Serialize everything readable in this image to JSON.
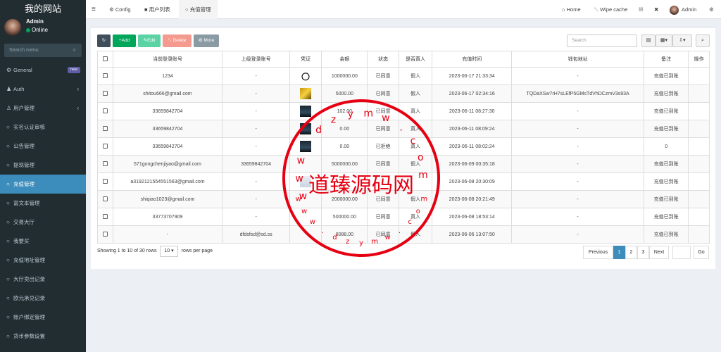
{
  "sidebar": {
    "site_name": "我的网站",
    "user_name": "Admin",
    "status": "Online",
    "search_placeholder": "Search menu",
    "items": [
      {
        "label": "General",
        "icon": "gears-icon",
        "badge": "new"
      },
      {
        "label": "Auth",
        "icon": "users-icon",
        "chevron": "‹"
      },
      {
        "label": "用户管理",
        "icon": "user-icon",
        "chevron": "‹"
      },
      {
        "label": "实名认证审核",
        "icon": "circle-icon"
      },
      {
        "label": "公告管理",
        "icon": "circle-icon"
      },
      {
        "label": "提现管理",
        "icon": "circle-icon"
      },
      {
        "label": "充值管理",
        "icon": "circle-icon",
        "active": true
      },
      {
        "label": "富文本管理",
        "icon": "circle-icon"
      },
      {
        "label": "交易大厅",
        "icon": "circle-icon"
      },
      {
        "label": "我要买",
        "icon": "circle-icon"
      },
      {
        "label": "充值地址管理",
        "icon": "circle-icon"
      },
      {
        "label": "大厅卖出记录",
        "icon": "circle-icon"
      },
      {
        "label": "欧元承兑记录",
        "icon": "circle-icon"
      },
      {
        "label": "账户绑定管理",
        "icon": "circle-icon"
      },
      {
        "label": "货币参数设置",
        "icon": "circle-icon"
      }
    ]
  },
  "topbar": {
    "menu_icon": "≡",
    "tabs": [
      {
        "label": "Config",
        "icon": "gear-icon"
      },
      {
        "label": "用户列表",
        "icon": "user-icon"
      },
      {
        "label": "充值管理",
        "icon": "circle-icon",
        "active": true
      }
    ],
    "home": "Home",
    "wipe_cache": "Wipe cache",
    "admin": "Admin"
  },
  "toolbar": {
    "add": "Add",
    "edit": "Edit",
    "delete": "Delete",
    "more": "More",
    "search_placeholder": "Search"
  },
  "table": {
    "columns": [
      "当前登录账号",
      "上级登录账号",
      "凭证",
      "金额",
      "状态",
      "是否真人",
      "充值时间",
      "钱包地址",
      "备注",
      "操作"
    ],
    "rows": [
      {
        "account": "1234",
        "parent": "-",
        "amount": "1000000.00",
        "status": "已同意",
        "status_color": "green",
        "real": "假人",
        "real_color": "green",
        "time": "2023-06-17 21:33:34",
        "wallet": "-",
        "note": "充值已到账",
        "thumb": "panda"
      },
      {
        "account": "shitou666@gmail.com",
        "parent": "-",
        "amount": "5000.00",
        "status": "已同意",
        "status_color": "green",
        "real": "假人",
        "real_color": "green",
        "time": "2023-06-17 02:34:16",
        "wallet": "TQDaXSw7rH7sLEfP5GMsTdVhDCzmV3s93A",
        "note": "充值已到账",
        "thumb": "gold"
      },
      {
        "account": "33659842704",
        "parent": "-",
        "amount": "102.00",
        "status": "已同意",
        "status_color": "green",
        "real": "真人",
        "real_color": "gray",
        "time": "2023-06-11 08:27:30",
        "wallet": "-",
        "note": "充值已到账",
        "thumb": "dark"
      },
      {
        "account": "33659842704",
        "parent": "-",
        "amount": "0.00",
        "status": "已同意",
        "status_color": "green",
        "real": "真人",
        "real_color": "gray",
        "time": "2023-06-11 08:09:24",
        "wallet": "-",
        "note": "充值已到账",
        "thumb": "dark"
      },
      {
        "account": "33659842704",
        "parent": "-",
        "amount": "0.00",
        "status": "已拒绝",
        "status_color": "red",
        "real": "真人",
        "real_color": "gray",
        "time": "2023-06-11 08:02:24",
        "wallet": "-",
        "note": "0",
        "thumb": "dark"
      },
      {
        "account": "571gongchenjiyao@gmail.com",
        "parent": "33659842704",
        "amount": "5000000.00",
        "status": "已同意",
        "status_color": "green",
        "real": "假人",
        "real_color": "green",
        "time": "2023-06-09 00:35:18",
        "wallet": "-",
        "note": "充值已到账",
        "thumb": "none"
      },
      {
        "account": "a3192121554551563@gmail.com",
        "parent": "-",
        "amount": "",
        "status": "",
        "status_color": "green",
        "real": "",
        "real_color": "green",
        "time": "2023-06-08 20:30:09",
        "wallet": "-",
        "note": "充值已到账",
        "thumb": "light"
      },
      {
        "account": "shiqiao1023@gmail.com",
        "parent": "-",
        "amount": "2000000.00",
        "status": "已同意",
        "status_color": "green",
        "real": "假人",
        "real_color": "green",
        "time": "2023-06-08 20:21:49",
        "wallet": "-",
        "note": "充值已到账",
        "thumb": "none"
      },
      {
        "account": "33773707909",
        "parent": "-",
        "amount": "500000.00",
        "status": "已同意",
        "status_color": "green",
        "real": "真人",
        "real_color": "gray",
        "time": "2023-06-08 18:53:14",
        "wallet": "-",
        "note": "充值已到账",
        "thumb": "none"
      },
      {
        "account": "-",
        "parent": "dfdsfsd@sd.ss",
        "amount": "8088.00",
        "status": "已同意",
        "status_color": "green",
        "real": "假人",
        "real_color": "green",
        "time": "2023-06-06 13:07:50",
        "wallet": "-",
        "note": "充值已到账",
        "thumb": "none"
      }
    ]
  },
  "footer": {
    "showing": "Showing 1 to 10 of 30 rows",
    "per_page": "10 ▾",
    "rows_per_page": "rows per page",
    "previous": "Previous",
    "pages": [
      "1",
      "2",
      "3"
    ],
    "next": "Next",
    "go": "Go"
  },
  "watermark": {
    "center_text": "道臻源码网",
    "ring_text": "w w w . d z y m w . c o m"
  },
  "colors": {
    "sidebar_bg": "#222d32",
    "active_blue": "#3c8dbc",
    "add_green": "#00a65a",
    "edit_green": "#5cd3a4",
    "delete_red": "#f59a8e",
    "more_gray": "#8a9ba3",
    "refresh_dark": "#3f4e5b",
    "stamp_red": "#e60012"
  }
}
